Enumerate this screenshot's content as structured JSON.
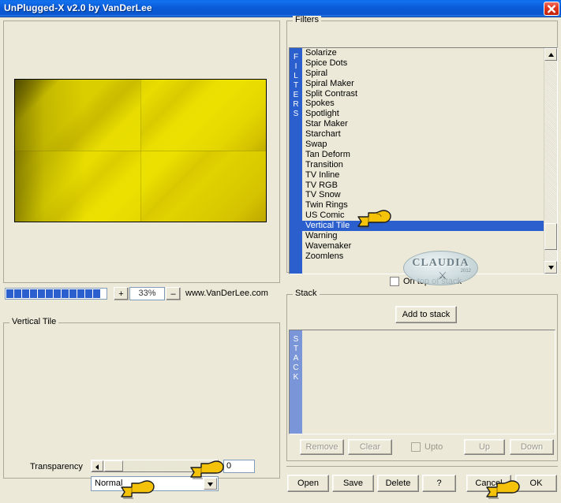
{
  "window": {
    "title": "UnPlugged-X v2.0 by VanDerLee",
    "close_icon": "close-icon",
    "titlebar_color": "#0b56ce",
    "accent_color": "#2b5fce",
    "face_color": "#ece9d8"
  },
  "preview": {
    "panel_name": "preview-panel",
    "image_description": "yellow vertical tile gradient preview"
  },
  "zoom": {
    "plus_label": "+",
    "minus_label": "–",
    "value": "33%",
    "website": "www.VanDerLee.com",
    "progress_blocks": 12
  },
  "filters": {
    "group_label": "Filters",
    "side_label": "FILTERS",
    "items": [
      "Solarize",
      "Spice Dots",
      "Spiral",
      "Spiral Maker",
      "Split Contrast",
      "Spokes",
      "Spotlight",
      "Star Maker",
      "Starchart",
      "Swap",
      "Tan Deform",
      "Transition",
      "TV Inline",
      "TV RGB",
      "TV Snow",
      "Twin Rings",
      "US Comic",
      "Vertical Tile",
      "Warning",
      "Wavemaker",
      "Zoomlens"
    ],
    "selected": "Vertical Tile",
    "on_top_of_stack": {
      "label": "On top of stack",
      "checked": false
    },
    "scroll_up_icon": "triangle-up-icon",
    "scroll_down_icon": "triangle-down-icon"
  },
  "params": {
    "group_label": "Vertical Tile",
    "transparency_label": "Transparency",
    "transparency_value": "0",
    "blend_mode": "Normal",
    "combo_arrow_icon": "chevron-down-icon",
    "slider_arrow_icon": "triangle-left-icon"
  },
  "stack": {
    "group_label": "Stack",
    "side_label": "STACK",
    "add_label": "Add to stack",
    "items": [],
    "buttons": [
      {
        "label": "Remove",
        "enabled": false
      },
      {
        "label": "Clear",
        "enabled": false
      },
      {
        "label": "Up",
        "enabled": false
      },
      {
        "label": "Down",
        "enabled": false
      }
    ],
    "upto": {
      "label": "Upto",
      "checked": false,
      "enabled": false
    }
  },
  "bottom_buttons": {
    "open": "Open",
    "save": "Save",
    "delete": "Delete",
    "help": "?",
    "cancel": "Cancel",
    "ok": "OK"
  },
  "watermark": {
    "text": "CLAUDIA",
    "sub": "2012"
  }
}
